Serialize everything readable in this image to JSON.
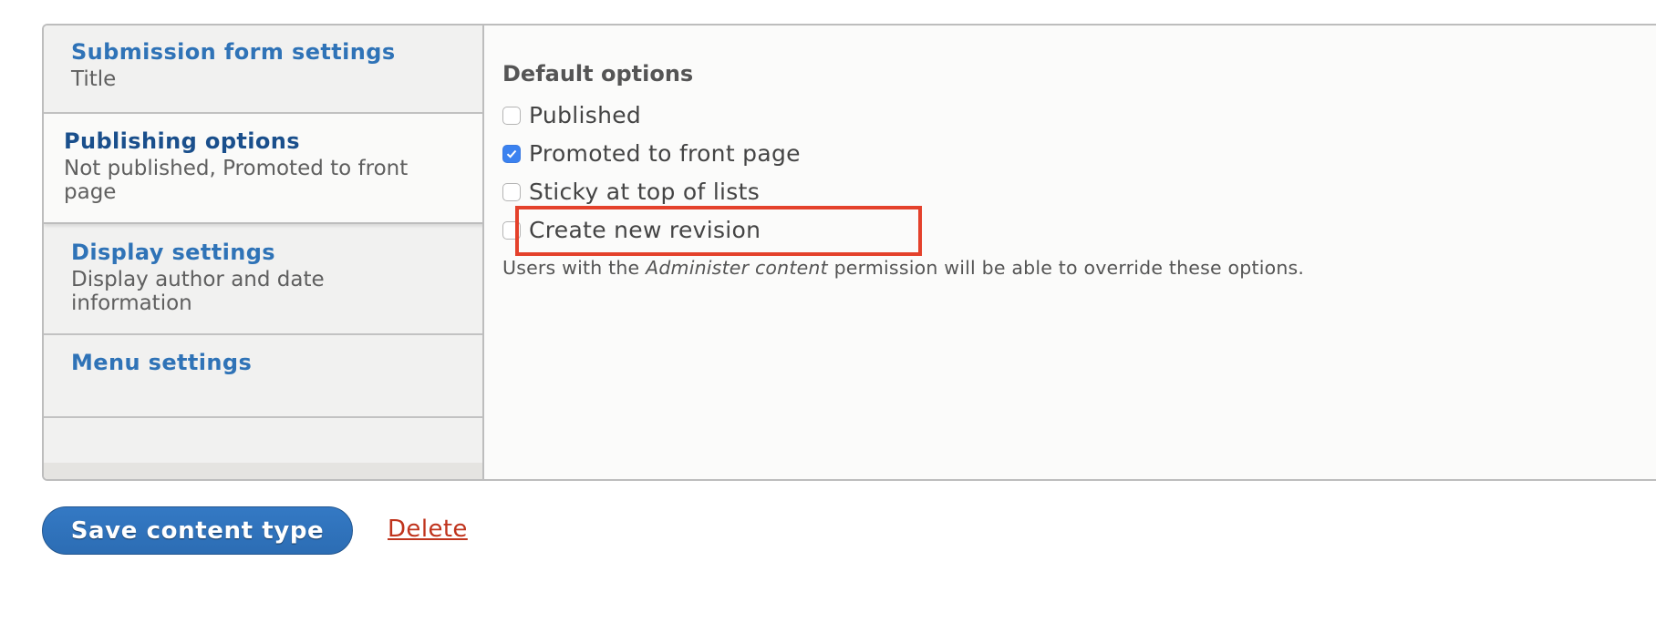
{
  "vertical_tabs": [
    {
      "title": "Submission form settings",
      "summary": "Title",
      "selected": false
    },
    {
      "title": "Publishing options",
      "summary": "Not published, Promoted to front page",
      "selected": true
    },
    {
      "title": "Display settings",
      "summary": "Display author and date information",
      "selected": false
    },
    {
      "title": "Menu settings",
      "summary": "",
      "selected": false
    }
  ],
  "publishing_pane": {
    "legend": "Default options",
    "options": [
      {
        "label": "Published",
        "checked": false
      },
      {
        "label": "Promoted to front page",
        "checked": true
      },
      {
        "label": "Sticky at top of lists",
        "checked": false
      },
      {
        "label": "Create new revision",
        "checked": false
      }
    ],
    "description": {
      "before": "Users with the ",
      "emphasis": "Administer content",
      "after": " permission will be able to override these options."
    }
  },
  "annotation": {
    "highlighted_option": "Create new revision",
    "color": "#e4412b"
  },
  "actions": {
    "save_label": "Save content type",
    "delete_label": "Delete"
  },
  "colors": {
    "link_blue": "#2f73b7",
    "selected_tab_title": "#1a4f8c",
    "checkbox_checked": "#3b82f0",
    "primary_button": "#2f73b7",
    "danger_link": "#c0341d"
  }
}
